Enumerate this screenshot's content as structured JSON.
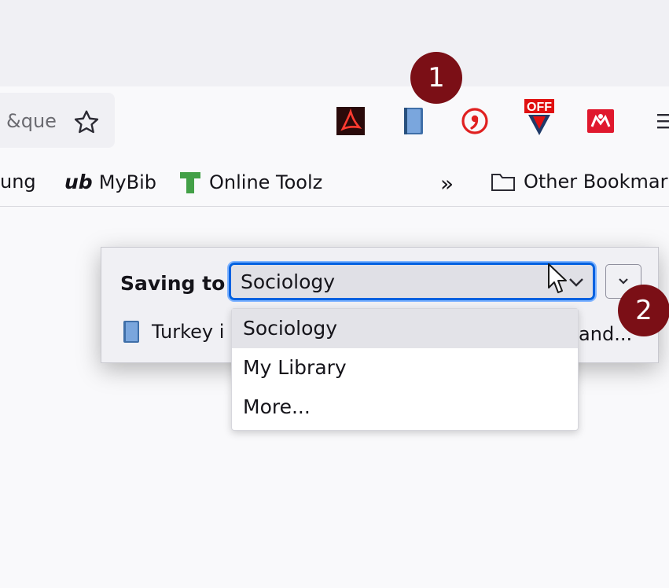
{
  "url_bar": {
    "text": "&que"
  },
  "toolbar_icons": [
    {
      "name": "adobe-acrobat-icon",
      "color": "#c00000"
    },
    {
      "name": "zotero-connector-icon",
      "color": "#4e7dbb"
    },
    {
      "name": "citation-icon",
      "color": "#e02020"
    },
    {
      "name": "adblock-off-icon",
      "label": "OFF",
      "color": "#e01010"
    },
    {
      "name": "mendeley-icon",
      "color": "#e0182d"
    },
    {
      "name": "menu-icon"
    }
  ],
  "bookmarks": {
    "items": [
      {
        "label": "ung"
      },
      {
        "prefix": "ub",
        "label": "MyBib"
      },
      {
        "label": "Online Toolz"
      }
    ],
    "overflow": "»",
    "other": "Other Bookmark"
  },
  "popup": {
    "saving_to_label": "Saving to",
    "selected_collection": "Sociology",
    "item_title": "Turkey i",
    "item_title_suffix": "t and..."
  },
  "dropdown": {
    "options": [
      "Sociology",
      "My Library",
      "More..."
    ],
    "selected_index": 0
  },
  "annotations": {
    "badge1": "1",
    "badge2": "2"
  },
  "colors": {
    "badge": "#7b0f16",
    "focus": "#0061e0"
  }
}
